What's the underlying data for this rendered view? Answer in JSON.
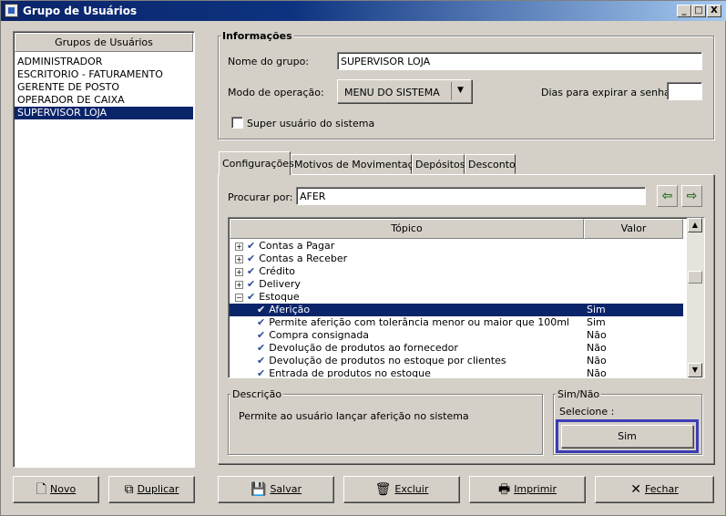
{
  "window": {
    "title": "Grupo de Usuários",
    "minimize": "_",
    "maximize": "□",
    "close": "X"
  },
  "groups_panel": {
    "header": "Grupos de Usuários",
    "items": [
      "ADMINISTRADOR",
      "ESCRITORIO - FATURAMENTO",
      "GERENTE DE POSTO",
      "OPERADOR DE CAIXA",
      "SUPERVISOR LOJA"
    ],
    "selected_index": 4
  },
  "info": {
    "title": "Informações",
    "group_name_label": "Nome do grupo:",
    "group_name_value": "SUPERVISOR LOJA",
    "mode_label": "Modo de operação:",
    "mode_value": "MENU DO SISTEMA",
    "expire_label": "Dias para expirar a senha:",
    "expire_value": "",
    "superuser_label": "Super usuário do sistema",
    "superuser_checked": false
  },
  "tabs": [
    "Configurações",
    "Motivos de Movimentação",
    "Depósitos",
    "Desconto"
  ],
  "active_tab": 0,
  "search": {
    "label": "Procurar por:",
    "value": "AFER"
  },
  "grid": {
    "col_topic": "Tópico",
    "col_value": "Valor",
    "rows": [
      {
        "topic": "Contas a Pagar",
        "value": "",
        "level": 0,
        "expander": "+"
      },
      {
        "topic": "Contas a Receber",
        "value": "",
        "level": 0,
        "expander": "+"
      },
      {
        "topic": "Crédito",
        "value": "",
        "level": 0,
        "expander": "+"
      },
      {
        "topic": "Delivery",
        "value": "",
        "level": 0,
        "expander": "+"
      },
      {
        "topic": "Estoque",
        "value": "",
        "level": 0,
        "expander": "−"
      },
      {
        "topic": "Aferição",
        "value": "Sim",
        "level": 1,
        "expander": ""
      },
      {
        "topic": "Permite aferição com tolerância menor ou maior que 100ml",
        "value": "Sim",
        "level": 1,
        "expander": ""
      },
      {
        "topic": "Compra consignada",
        "value": "Não",
        "level": 1,
        "expander": ""
      },
      {
        "topic": "Devolução de produtos ao fornecedor",
        "value": "Não",
        "level": 1,
        "expander": ""
      },
      {
        "topic": "Devolução de produtos no estoque por clientes",
        "value": "Não",
        "level": 1,
        "expander": ""
      },
      {
        "topic": "Entrada de produtos no estoque",
        "value": "Não",
        "level": 1,
        "expander": ""
      }
    ],
    "selected_index": 5
  },
  "description": {
    "title": "Descrição",
    "text": "Permite ao usuário lançar aferição no sistema"
  },
  "simnao": {
    "title": "Sim/Não",
    "select_label": "Selecione :",
    "button": "Sim"
  },
  "buttons": {
    "novo": "Novo",
    "duplicar": "Duplicar",
    "salvar": "Salvar",
    "excluir": "Excluir",
    "imprimir": "Imprimir",
    "fechar": "Fechar"
  }
}
